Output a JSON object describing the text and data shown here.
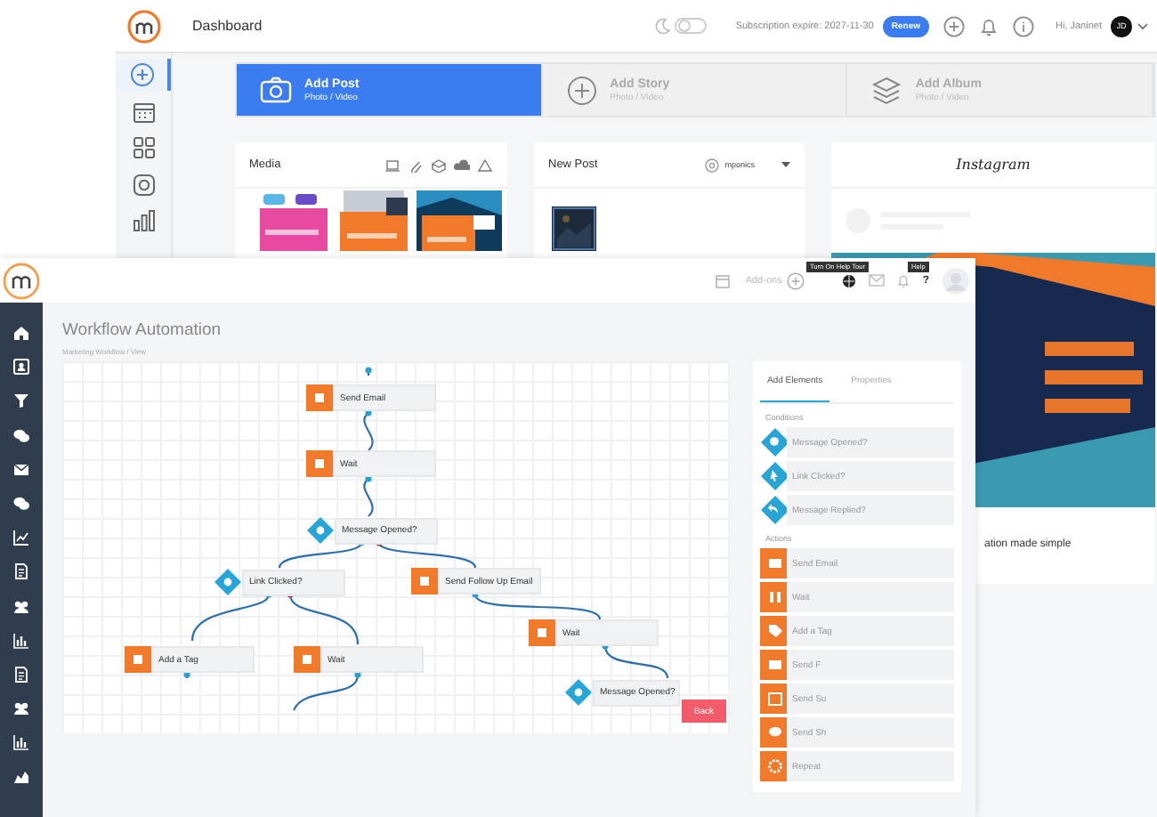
{
  "dashboard": {
    "title": "Dashboard",
    "dark_mode": false,
    "subscription": "Subscription expire: 2027-11-30",
    "renew_button": "Renew",
    "greeting": "Hi, Janinet",
    "avatar": "JD",
    "sidebar": [
      {
        "selected": true
      },
      {
        "selected": false
      },
      {
        "selected": false
      },
      {
        "selected": false
      },
      {
        "selected": false
      }
    ],
    "post_types": [
      {
        "title": "Add Post",
        "subtitle": "Photo / Video",
        "selected": true
      },
      {
        "title": "Add Story",
        "subtitle": "Photo / Video",
        "selected": false
      },
      {
        "title": "Add Album",
        "subtitle": "Photo / Video",
        "selected": false
      }
    ],
    "media": {
      "title": "Media"
    },
    "new_post": {
      "title": "New Post",
      "account": "mponics"
    },
    "instagram": {
      "title": "Instagram",
      "caption": "ation made simple"
    }
  },
  "workflow": {
    "addons": "Add-ons",
    "tooltips": [
      "Turn On Help Tour",
      "Help"
    ],
    "help_glyph": "?",
    "title": "Workflow Automation",
    "breadcrumb": "Marketing Workflow  /  View",
    "nodes": [
      {
        "kind": "action",
        "label": "Send Email"
      },
      {
        "kind": "action",
        "label": "Wait"
      },
      {
        "kind": "condition",
        "label": "Message Opened?"
      },
      {
        "kind": "condition",
        "label": "Link Clicked?"
      },
      {
        "kind": "action",
        "label": "Send Follow Up Email"
      },
      {
        "kind": "action",
        "label": "Wait"
      },
      {
        "kind": "action",
        "label": "Add a Tag"
      },
      {
        "kind": "action",
        "label": "Wait"
      },
      {
        "kind": "condition",
        "label": "Message Opened?"
      }
    ],
    "back_button": "Back",
    "panel": {
      "tabs": [
        {
          "label": "Add Elements",
          "selected": true
        },
        {
          "label": "Properties",
          "selected": false
        }
      ],
      "conditions_label": "Conditions",
      "conditions": [
        "Message Opened?",
        "Link Clicked?",
        "Message Replied?"
      ],
      "actions_label": "Actions",
      "actions": [
        "Send Email",
        "Wait",
        "Add a Tag",
        "Send F",
        "Send Su",
        "Send Sh",
        "Repeat"
      ]
    }
  }
}
